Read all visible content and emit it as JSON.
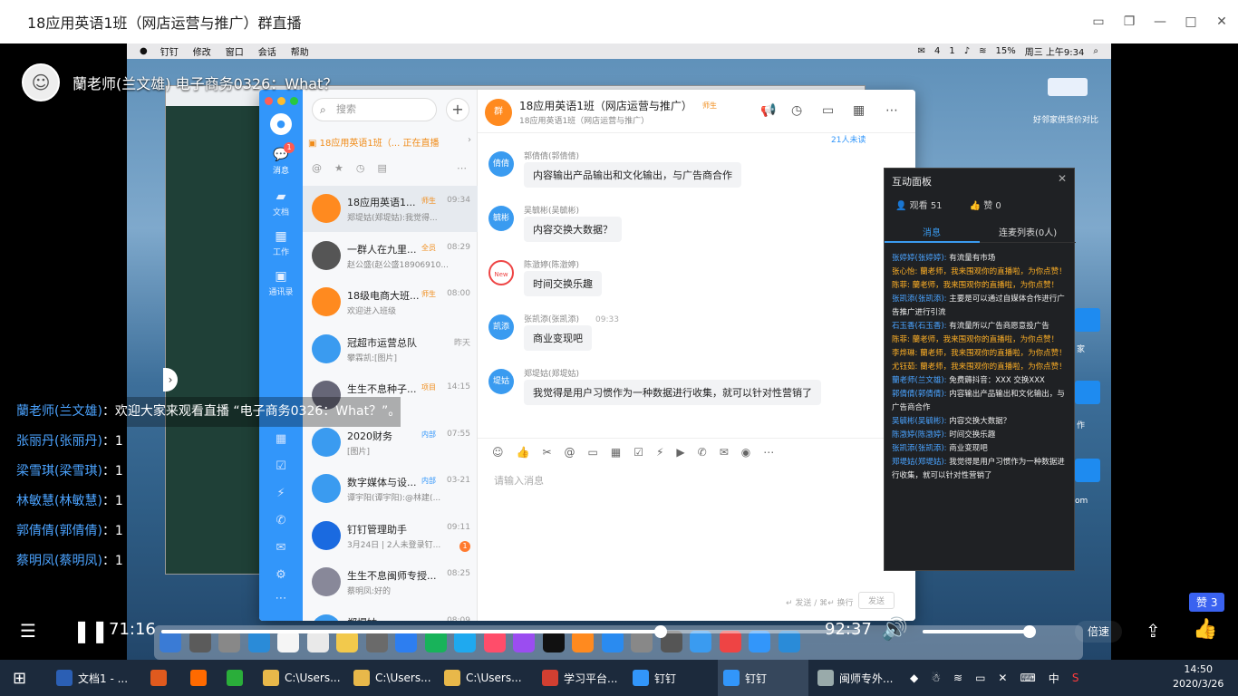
{
  "window": {
    "title": "18应用英语1班（网店运营与推广）群直播"
  },
  "presenter": {
    "name": "蘭老师(兰文雄) 电子商务0326：What？"
  },
  "mac_menu": {
    "items": [
      "钉钉",
      "修改",
      "窗口",
      "会话",
      "帮助"
    ],
    "status": [
      "4",
      "1",
      "15%",
      "周三 上午9:34"
    ]
  },
  "dingtalk": {
    "rail": {
      "items": [
        "消息",
        "文档",
        "工作",
        "通讯录"
      ],
      "badge": "1"
    },
    "search_placeholder": "搜索",
    "live_banner": "18应用英语1班（... 正在直播",
    "conversations": [
      {
        "name": "18应用英语1...",
        "tag": "师生",
        "time": "09:34",
        "preview": "郑堤姑(郑堤姑):我觉得...",
        "avatar_color": "#ff8a1f",
        "selected": true
      },
      {
        "name": "一群人在九里...",
        "tag": "全员",
        "time": "08:29",
        "preview": "赵公盛(赵公盛18906910...",
        "avatar_color": "#555"
      },
      {
        "name": "18级电商大班...",
        "tag": "师生",
        "time": "08:00",
        "preview": "欢迎进入班级",
        "avatar_color": "#ff8a1f"
      },
      {
        "name": "冠超市运营总队",
        "tag": "",
        "time": "昨天",
        "preview": "攀霖凯:[图片]",
        "avatar_color": "#3a9bf0"
      },
      {
        "name": "生生不息种子...",
        "tag": "项目",
        "time": "14:15",
        "preview": "",
        "avatar_color": "#667"
      },
      {
        "name": "2020财务",
        "tag": "内部",
        "time": "07:55",
        "preview": "[图片]",
        "avatar_color": "#3a9bf0"
      },
      {
        "name": "数字媒体与设...",
        "tag": "内部",
        "time": "03-21",
        "preview": "谭宇阳(谭宇阳):@林建(...",
        "avatar_color": "#3a9bf0"
      },
      {
        "name": "钉钉管理助手",
        "tag": "",
        "time": "09:11",
        "preview": "3月24日 | 2人未登录钉...",
        "avatar_color": "#1a6ae0",
        "unread": "1"
      },
      {
        "name": "生生不息闽师专授...",
        "tag": "",
        "time": "08:25",
        "preview": "蔡明凤:好的",
        "avatar_color": "#889"
      },
      {
        "name": "郑堤姑",
        "tag": "",
        "time": "08:09",
        "preview": "",
        "avatar_color": "#3a9bf0"
      }
    ],
    "chat": {
      "group_name": "18应用英语1班（网店运营与推广）",
      "group_tag": "师生",
      "group_sub": "18应用英语1班（网店运营与推广）",
      "more_link": "21人未读",
      "messages": [
        {
          "avatar": "倩倩",
          "sender": "郭倩倩(郭倩倩)",
          "time": "",
          "text": "内容输出产品输出和文化输出，与广告商合作"
        },
        {
          "avatar": "毓彬",
          "sender": "吴毓彬(吴毓彬)",
          "time": "",
          "text": "内容交换大数据？"
        },
        {
          "avatar": "New",
          "sender": "陈澂婷(陈澂婷)",
          "time": "",
          "text": "时间交换乐趣"
        },
        {
          "avatar": "凯添",
          "sender": "张凯添(张凯添)",
          "time": "09:33",
          "text": "商业变现吧"
        },
        {
          "avatar": "堤姑",
          "sender": "郑堤姑(郑堤姑)",
          "time": "",
          "text": "我觉得是用户习惯作为一种数据进行收集，就可以针对性营销了"
        }
      ],
      "input_placeholder": "请输入消息",
      "send_hint": "↵ 发送 / ⌘↵ 换行",
      "send_label": "发送"
    }
  },
  "panel": {
    "title": "互动面板",
    "viewers": "观看 51",
    "likes": "赞 0",
    "tab_messages": "消息",
    "tab_link": "连麦列表(0人)",
    "feed": [
      {
        "user": "张婷婷(张婷婷):",
        "text": " 有流量有市场",
        "orange": false
      },
      {
        "user": "张心怡:",
        "text": " 蘭老师，我来围观你的直播啦，为你点赞！",
        "orange": true
      },
      {
        "user": "陈菲:",
        "text": " 蘭老师，我来围观你的直播啦，为你点赞！",
        "orange": true
      },
      {
        "user": "张凯添(张凯添):",
        "text": " 主要是可以通过自媒体合作进行广告推广进行引流",
        "orange": false
      },
      {
        "user": "石玉香(石玉香):",
        "text": " 有流量所以广告商愿意投广告",
        "orange": false
      },
      {
        "user": "陈菲:",
        "text": " 蘭老师，我来围观你的直播啦，为你点赞！",
        "orange": true
      },
      {
        "user": "李烨琳:",
        "text": " 蘭老师，我来围观你的直播啦，为你点赞！",
        "orange": true
      },
      {
        "user": "尤钰茹:",
        "text": " 蘭老师，我来围观你的直播啦，为你点赞！",
        "orange": true
      },
      {
        "user": "蘭老师(兰文雄):",
        "text": " 免费薅抖音：XXX 交换XXX",
        "orange": false
      },
      {
        "user": "郭倩倩(郭倩倩):",
        "text": " 内容输出产品输出和文化输出，与广告商合作",
        "orange": false
      },
      {
        "user": "吴毓彬(吴毓彬):",
        "text": " 内容交换大数据？",
        "orange": false
      },
      {
        "user": "陈澂婷(陈澂婷):",
        "text": " 时间交换乐趣",
        "orange": false
      },
      {
        "user": "张凯添(张凯添):",
        "text": " 商业变现吧",
        "orange": false
      },
      {
        "user": "郑堤姑(郑堤姑):",
        "text": " 我觉得是用户习惯作为一种数据进行收集，就可以针对性营销了",
        "orange": false
      }
    ]
  },
  "desktop_labels": {
    "top_right": "好邻家供货价对比",
    "l1": "家",
    "l2": "作",
    "l3": "om"
  },
  "overlay_comments": [
    {
      "user": "蘭老师(兰文雄)",
      "text": "：欢迎大家来观看直播 “电子商务0326：What？”。"
    },
    {
      "user": "张丽丹(张丽丹)",
      "text": "：1"
    },
    {
      "user": "梁雪琪(梁雪琪)",
      "text": "：1"
    },
    {
      "user": "林敏慧(林敏慧)",
      "text": "：1"
    },
    {
      "user": "郭倩倩(郭倩倩)",
      "text": "：1"
    },
    {
      "user": "蔡明凤(蔡明凤)",
      "text": "：1"
    }
  ],
  "player": {
    "current_time": "71:16",
    "total_time": "92:37",
    "progress": 0.716,
    "volume": 0.97,
    "speed_label": "倍速",
    "like_count": "赞 3"
  },
  "taskbar": {
    "items": [
      {
        "label": "文档1 - ...",
        "color": "#2b5fb4",
        "active": false
      },
      {
        "label": "",
        "color": "#e05a1e",
        "active": false
      },
      {
        "label": "",
        "color": "#ff6a00",
        "active": false
      },
      {
        "label": "",
        "color": "#2aae3a",
        "active": false
      },
      {
        "label": "C:\\Users...",
        "color": "#e8b84a",
        "active": false
      },
      {
        "label": "C:\\Users...",
        "color": "#e8b84a",
        "active": false
      },
      {
        "label": "C:\\Users...",
        "color": "#e8b84a",
        "active": false
      },
      {
        "label": "学习平台...",
        "color": "#d23f31",
        "active": false
      },
      {
        "label": "钉钉",
        "color": "#3296fa",
        "active": false
      },
      {
        "label": "钉钉",
        "color": "#3296fa",
        "active": true
      },
      {
        "label": "闽师专外...",
        "color": "#9aa",
        "active": false
      }
    ],
    "ime": "中",
    "time": "14:50",
    "date": "2020/3/26"
  },
  "colors": {
    "dingtalk_blue": "#3296fa",
    "orange": "#f08c1a",
    "link_blue": "#4ba3ff"
  }
}
